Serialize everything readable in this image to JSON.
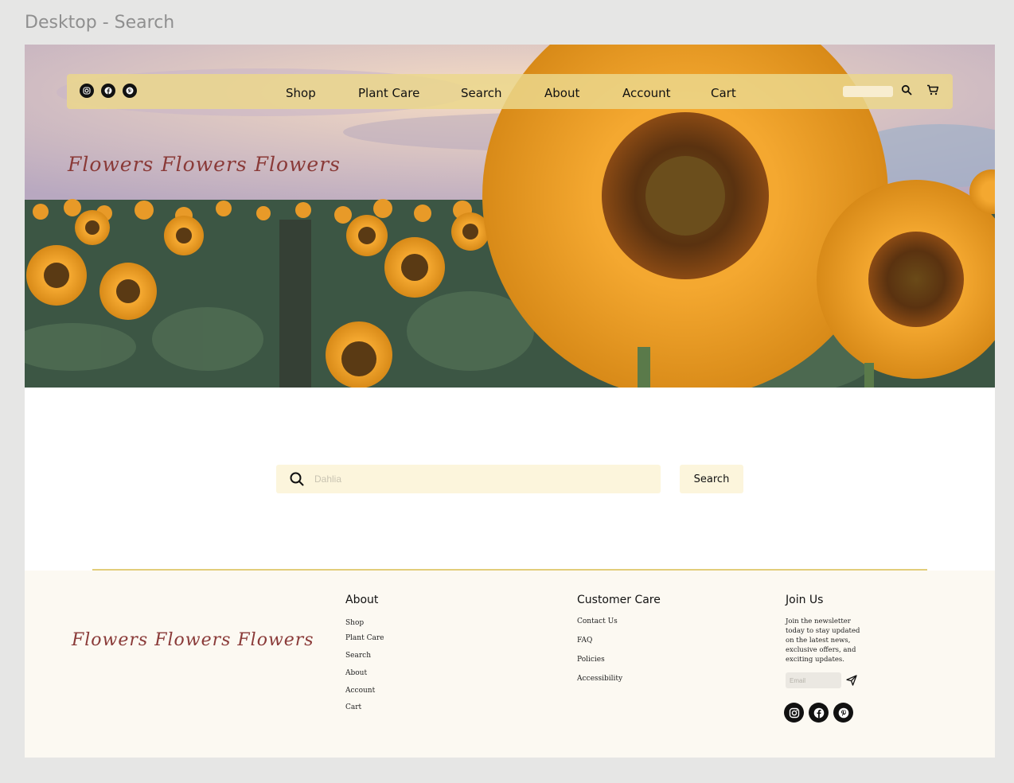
{
  "frame_label": "Desktop - Search",
  "nav": {
    "social_icons": [
      "instagram-icon",
      "facebook-icon",
      "pinterest-icon"
    ],
    "links": [
      "Shop",
      "Plant Care",
      "Search",
      "About",
      "Account",
      "Cart"
    ],
    "search_placeholder": "",
    "right_icons": [
      "search-icon",
      "cart-icon"
    ]
  },
  "hero": {
    "script_title": "Flowers Flowers Flowers"
  },
  "search": {
    "placeholder": "Dahlia",
    "button_label": "Search"
  },
  "footer": {
    "brand_script": "Flowers Flowers Flowers",
    "about": {
      "heading": "About",
      "links": [
        "Shop",
        "Plant Care",
        "Search",
        "About",
        "Account",
        "Cart"
      ]
    },
    "customer_care": {
      "heading": "Customer Care",
      "links": [
        "Contact Us",
        "FAQ",
        "Policies",
        "Accessibility"
      ]
    },
    "join": {
      "heading": "Join Us",
      "text": "Join the newsletter today to stay updated on the latest news, exclusive offers, and exciting updates.",
      "email_placeholder": "Email",
      "social_icons": [
        "instagram-icon",
        "facebook-icon",
        "pinterest-icon"
      ]
    }
  },
  "colors": {
    "navbar": "#ebd78c",
    "search_bg": "#fcf5dc",
    "footer_bg": "#fcf9f2",
    "divider": "#e2cd7a",
    "script": "#8a3a38"
  }
}
